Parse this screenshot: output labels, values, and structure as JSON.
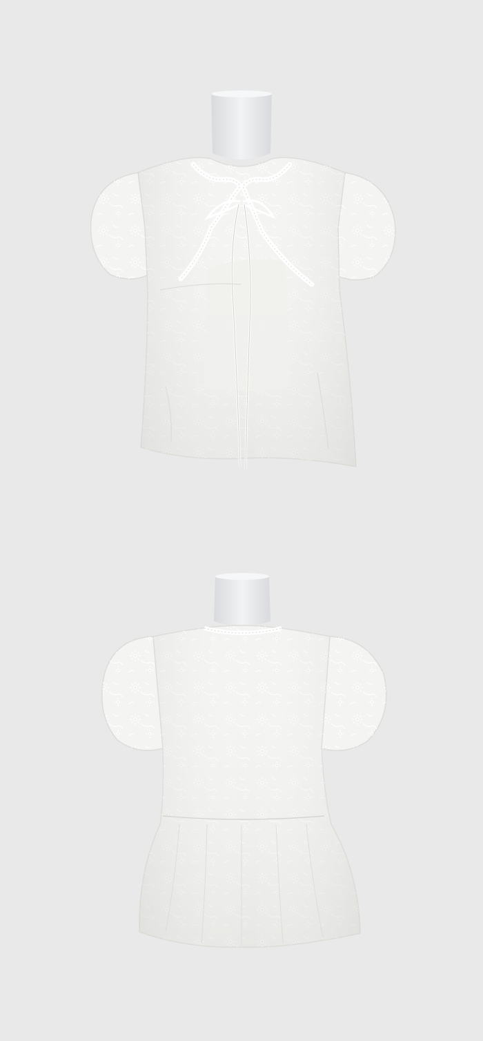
{
  "background_color": "#e9e9e9",
  "photos": [
    {
      "view": "front",
      "garment_color": "#f4f4f2",
      "mannequin_color": "#e6e8ea"
    },
    {
      "view": "back",
      "garment_color": "#f4f4f2",
      "mannequin_color": "#e6e8ea"
    }
  ]
}
